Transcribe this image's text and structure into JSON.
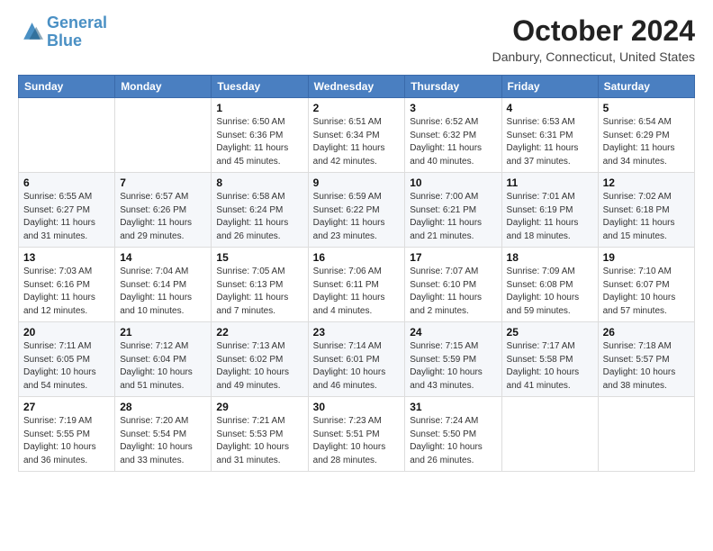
{
  "header": {
    "logo_line1": "General",
    "logo_line2": "Blue",
    "month": "October 2024",
    "location": "Danbury, Connecticut, United States"
  },
  "weekdays": [
    "Sunday",
    "Monday",
    "Tuesday",
    "Wednesday",
    "Thursday",
    "Friday",
    "Saturday"
  ],
  "weeks": [
    [
      {
        "day": "",
        "info": ""
      },
      {
        "day": "",
        "info": ""
      },
      {
        "day": "1",
        "info": "Sunrise: 6:50 AM\nSunset: 6:36 PM\nDaylight: 11 hours and 45 minutes."
      },
      {
        "day": "2",
        "info": "Sunrise: 6:51 AM\nSunset: 6:34 PM\nDaylight: 11 hours and 42 minutes."
      },
      {
        "day": "3",
        "info": "Sunrise: 6:52 AM\nSunset: 6:32 PM\nDaylight: 11 hours and 40 minutes."
      },
      {
        "day": "4",
        "info": "Sunrise: 6:53 AM\nSunset: 6:31 PM\nDaylight: 11 hours and 37 minutes."
      },
      {
        "day": "5",
        "info": "Sunrise: 6:54 AM\nSunset: 6:29 PM\nDaylight: 11 hours and 34 minutes."
      }
    ],
    [
      {
        "day": "6",
        "info": "Sunrise: 6:55 AM\nSunset: 6:27 PM\nDaylight: 11 hours and 31 minutes."
      },
      {
        "day": "7",
        "info": "Sunrise: 6:57 AM\nSunset: 6:26 PM\nDaylight: 11 hours and 29 minutes."
      },
      {
        "day": "8",
        "info": "Sunrise: 6:58 AM\nSunset: 6:24 PM\nDaylight: 11 hours and 26 minutes."
      },
      {
        "day": "9",
        "info": "Sunrise: 6:59 AM\nSunset: 6:22 PM\nDaylight: 11 hours and 23 minutes."
      },
      {
        "day": "10",
        "info": "Sunrise: 7:00 AM\nSunset: 6:21 PM\nDaylight: 11 hours and 21 minutes."
      },
      {
        "day": "11",
        "info": "Sunrise: 7:01 AM\nSunset: 6:19 PM\nDaylight: 11 hours and 18 minutes."
      },
      {
        "day": "12",
        "info": "Sunrise: 7:02 AM\nSunset: 6:18 PM\nDaylight: 11 hours and 15 minutes."
      }
    ],
    [
      {
        "day": "13",
        "info": "Sunrise: 7:03 AM\nSunset: 6:16 PM\nDaylight: 11 hours and 12 minutes."
      },
      {
        "day": "14",
        "info": "Sunrise: 7:04 AM\nSunset: 6:14 PM\nDaylight: 11 hours and 10 minutes."
      },
      {
        "day": "15",
        "info": "Sunrise: 7:05 AM\nSunset: 6:13 PM\nDaylight: 11 hours and 7 minutes."
      },
      {
        "day": "16",
        "info": "Sunrise: 7:06 AM\nSunset: 6:11 PM\nDaylight: 11 hours and 4 minutes."
      },
      {
        "day": "17",
        "info": "Sunrise: 7:07 AM\nSunset: 6:10 PM\nDaylight: 11 hours and 2 minutes."
      },
      {
        "day": "18",
        "info": "Sunrise: 7:09 AM\nSunset: 6:08 PM\nDaylight: 10 hours and 59 minutes."
      },
      {
        "day": "19",
        "info": "Sunrise: 7:10 AM\nSunset: 6:07 PM\nDaylight: 10 hours and 57 minutes."
      }
    ],
    [
      {
        "day": "20",
        "info": "Sunrise: 7:11 AM\nSunset: 6:05 PM\nDaylight: 10 hours and 54 minutes."
      },
      {
        "day": "21",
        "info": "Sunrise: 7:12 AM\nSunset: 6:04 PM\nDaylight: 10 hours and 51 minutes."
      },
      {
        "day": "22",
        "info": "Sunrise: 7:13 AM\nSunset: 6:02 PM\nDaylight: 10 hours and 49 minutes."
      },
      {
        "day": "23",
        "info": "Sunrise: 7:14 AM\nSunset: 6:01 PM\nDaylight: 10 hours and 46 minutes."
      },
      {
        "day": "24",
        "info": "Sunrise: 7:15 AM\nSunset: 5:59 PM\nDaylight: 10 hours and 43 minutes."
      },
      {
        "day": "25",
        "info": "Sunrise: 7:17 AM\nSunset: 5:58 PM\nDaylight: 10 hours and 41 minutes."
      },
      {
        "day": "26",
        "info": "Sunrise: 7:18 AM\nSunset: 5:57 PM\nDaylight: 10 hours and 38 minutes."
      }
    ],
    [
      {
        "day": "27",
        "info": "Sunrise: 7:19 AM\nSunset: 5:55 PM\nDaylight: 10 hours and 36 minutes."
      },
      {
        "day": "28",
        "info": "Sunrise: 7:20 AM\nSunset: 5:54 PM\nDaylight: 10 hours and 33 minutes."
      },
      {
        "day": "29",
        "info": "Sunrise: 7:21 AM\nSunset: 5:53 PM\nDaylight: 10 hours and 31 minutes."
      },
      {
        "day": "30",
        "info": "Sunrise: 7:23 AM\nSunset: 5:51 PM\nDaylight: 10 hours and 28 minutes."
      },
      {
        "day": "31",
        "info": "Sunrise: 7:24 AM\nSunset: 5:50 PM\nDaylight: 10 hours and 26 minutes."
      },
      {
        "day": "",
        "info": ""
      },
      {
        "day": "",
        "info": ""
      }
    ]
  ]
}
